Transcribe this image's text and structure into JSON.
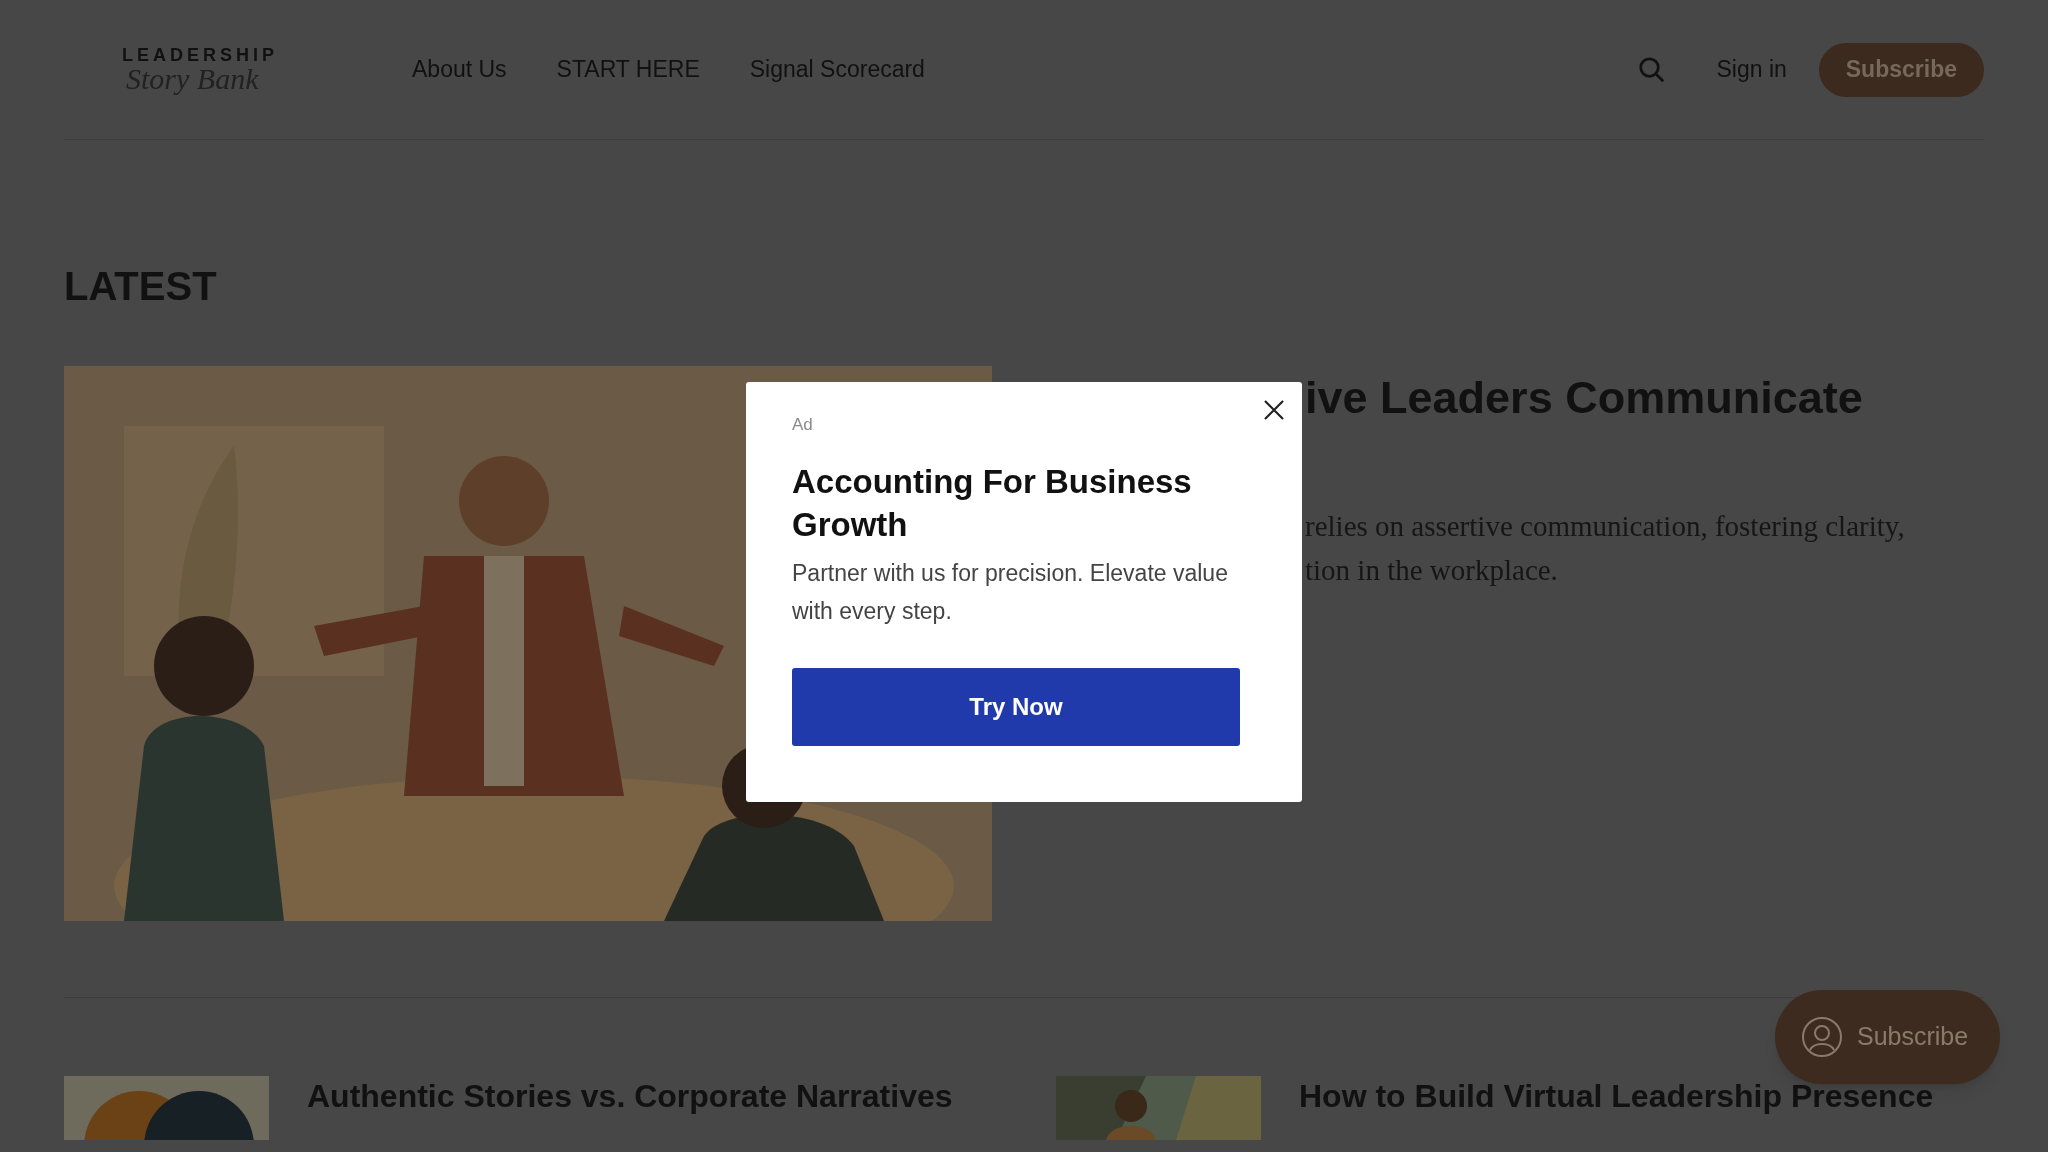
{
  "header": {
    "logo": {
      "top": "LEADERSHIP",
      "script": "Story Bank"
    },
    "nav": [
      "About Us",
      "START HERE",
      "Signal Scorecard"
    ],
    "sign_in": "Sign in",
    "subscribe": "Subscribe"
  },
  "section_title": "LATEST",
  "featured": {
    "headline": "ive Leaders Communicate",
    "excerpt_lines": [
      "relies on assertive communication, fostering clarity,",
      "tion in the workplace."
    ]
  },
  "posts": [
    {
      "title": "Authentic Stories vs. Corporate Narratives",
      "kind": "circles"
    },
    {
      "title": "How to Build Virtual Leadership Presence",
      "kind": "person"
    }
  ],
  "ad": {
    "label": "Ad",
    "title": "Accounting For Business Growth",
    "body": "Partner with us for precision. Elevate value with every step.",
    "button": "Try Now"
  },
  "floating_subscribe": "Subscribe"
}
